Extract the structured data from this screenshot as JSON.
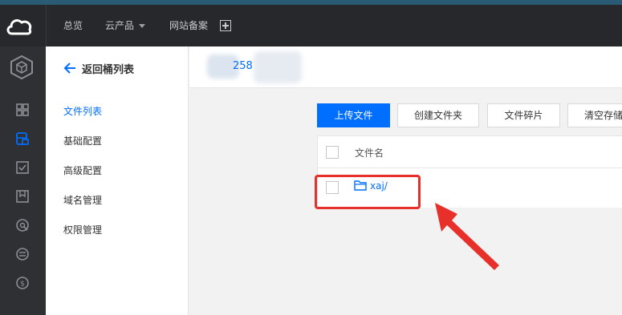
{
  "topbar": {
    "nav": [
      "总览",
      "云产品",
      "网站备案"
    ]
  },
  "sidebar_icons": [
    "grid-icon",
    "storage-icon",
    "checkbox-icon",
    "bookmark-icon",
    "network-icon",
    "cdn-icon",
    "billing-icon"
  ],
  "subnav": {
    "back_label": "返回桶列表",
    "items": [
      "文件列表",
      "基础配置",
      "高级配置",
      "域名管理",
      "权限管理"
    ]
  },
  "bucket": {
    "name_fragment": "258"
  },
  "toolbar": {
    "upload": "上传文件",
    "create_folder": "创建文件夹",
    "fragments": "文件碎片",
    "clear": "清空存储"
  },
  "table": {
    "header": "文件名",
    "rows": [
      {
        "name": "xaj/"
      }
    ]
  },
  "colors": {
    "accent": "#006eff",
    "topbar": "#27282b",
    "annotation": "#e8302a"
  }
}
